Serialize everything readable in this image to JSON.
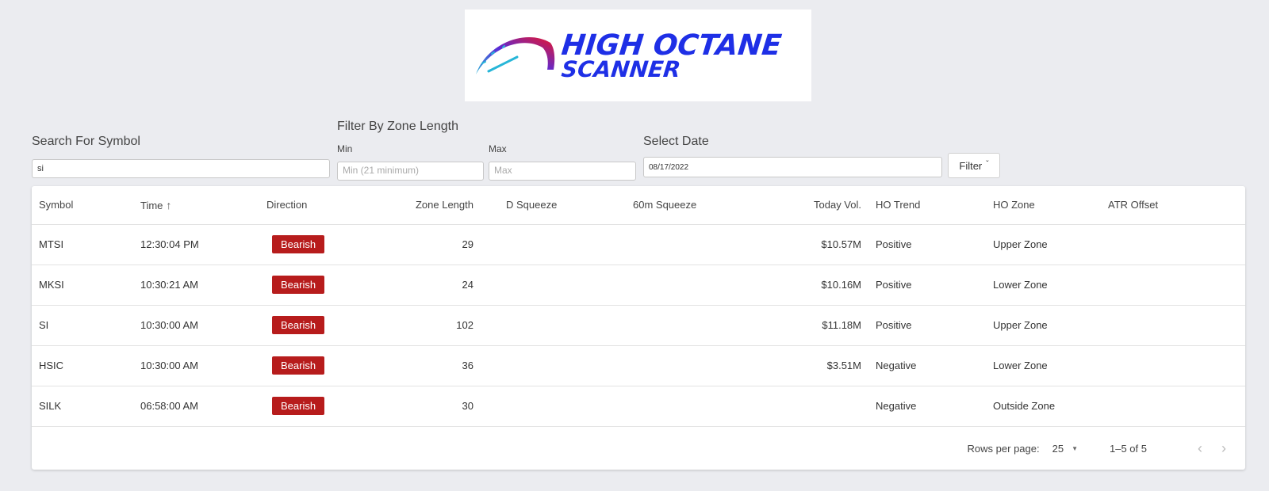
{
  "logo": {
    "line1": "HIGH OCTANE",
    "line2": "SCANNER",
    "brand_color": "#1e2fe6",
    "gauge_colors": [
      "#e8162c",
      "#5b2bd6",
      "#27b6d8"
    ]
  },
  "filters": {
    "search_label": "Search For Symbol",
    "search_value": "si",
    "zone_label": "Filter By Zone Length",
    "min_label": "Min",
    "min_placeholder": "Min (21 minimum)",
    "max_label": "Max",
    "max_placeholder": "Max",
    "date_label": "Select Date",
    "date_value": "08/17/2022",
    "filter_button": "Filter",
    "filter_icon": "chevron-down-icon"
  },
  "table": {
    "columns": [
      "Symbol",
      "Time",
      "Direction",
      "Zone Length",
      "D Squeeze",
      "60m Squeeze",
      "Today Vol.",
      "HO Trend",
      "HO Zone",
      "ATR Offset"
    ],
    "sort_icon": "arrow-up-icon",
    "badge_color": "#b71c1c",
    "rows": [
      {
        "symbol": "MTSI",
        "time": "12:30:04 PM",
        "direction": "Bearish",
        "zone_length": "29",
        "d_squeeze": "",
        "squeeze_60m": "",
        "today_vol": "$10.57M",
        "ho_trend": "Positive",
        "ho_zone": "Upper Zone",
        "atr_offset": ""
      },
      {
        "symbol": "MKSI",
        "time": "10:30:21 AM",
        "direction": "Bearish",
        "zone_length": "24",
        "d_squeeze": "",
        "squeeze_60m": "",
        "today_vol": "$10.16M",
        "ho_trend": "Positive",
        "ho_zone": "Lower Zone",
        "atr_offset": ""
      },
      {
        "symbol": "SI",
        "time": "10:30:00 AM",
        "direction": "Bearish",
        "zone_length": "102",
        "d_squeeze": "",
        "squeeze_60m": "",
        "today_vol": "$11.18M",
        "ho_trend": "Positive",
        "ho_zone": "Upper Zone",
        "atr_offset": ""
      },
      {
        "symbol": "HSIC",
        "time": "10:30:00 AM",
        "direction": "Bearish",
        "zone_length": "36",
        "d_squeeze": "",
        "squeeze_60m": "",
        "today_vol": "$3.51M",
        "ho_trend": "Negative",
        "ho_zone": "Lower Zone",
        "atr_offset": ""
      },
      {
        "symbol": "SILK",
        "time": "06:58:00 AM",
        "direction": "Bearish",
        "zone_length": "30",
        "d_squeeze": "",
        "squeeze_60m": "",
        "today_vol": "",
        "ho_trend": "Negative",
        "ho_zone": "Outside Zone",
        "atr_offset": ""
      }
    ]
  },
  "pagination": {
    "rows_per_page_label": "Rows per page:",
    "rows_per_page_value": "25",
    "range": "1–5 of 5",
    "prev_icon": "chevron-left-icon",
    "next_icon": "chevron-right-icon"
  }
}
